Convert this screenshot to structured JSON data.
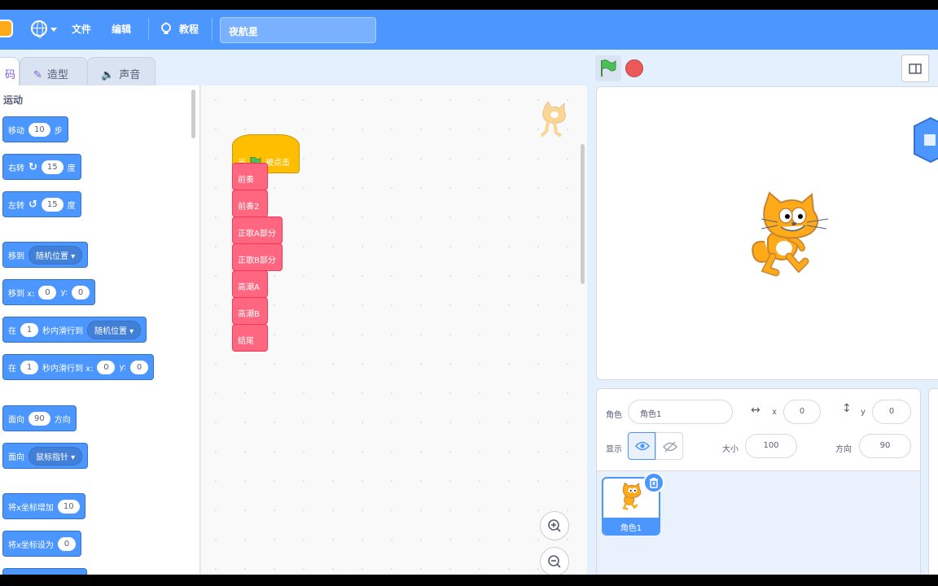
{
  "menubar": {
    "file": "文件",
    "edit": "编辑",
    "tutorials": "教程",
    "project_title": "夜航星"
  },
  "tabs": {
    "code": "码",
    "costumes": "造型",
    "sounds": "声音"
  },
  "palette": {
    "category": "运动",
    "blocks": {
      "move": {
        "a": "移动",
        "v": "10",
        "b": "步"
      },
      "turn_right": {
        "a": "右转",
        "v": "15",
        "b": "度"
      },
      "turn_left": {
        "a": "左转",
        "v": "15",
        "b": "度"
      },
      "goto": {
        "a": "移到",
        "d": "随机位置"
      },
      "goto_xy": {
        "a": "移到 x:",
        "x": "0",
        "ylabel": "y:",
        "y": "0"
      },
      "glide": {
        "a": "在",
        "v": "1",
        "b": "秒内滑行到",
        "d": "随机位置"
      },
      "glide_xy": {
        "a": "在",
        "v": "1",
        "b": "秒内滑行到 x:",
        "x": "0",
        "ylabel": "y:",
        "y": "0"
      },
      "point_dir": {
        "a": "面向",
        "v": "90",
        "b": "方向"
      },
      "point_towards": {
        "a": "面向",
        "d": "鼠标指针"
      },
      "change_x": {
        "a": "将x坐标增加",
        "v": "10"
      },
      "set_x": {
        "a": "将x坐标设为",
        "v": "0"
      }
    }
  },
  "script": {
    "hat": {
      "a": "当",
      "b": "被点击"
    },
    "blocks": [
      "前奏",
      "前奏2",
      "正歌A部分",
      "正歌B部分",
      "高潮A",
      "高潮B",
      "结尾"
    ]
  },
  "sprite_info": {
    "sprite_label": "角色",
    "sprite_name": "角色1",
    "x_label": "x",
    "x": "0",
    "y_label": "y",
    "y": "0",
    "show_label": "显示",
    "size_label": "大小",
    "size": "100",
    "direction_label": "方向",
    "direction": "90"
  },
  "sprite_list": [
    {
      "name": "角色1"
    }
  ],
  "colors": {
    "accent": "#4c97ff",
    "motion": "#4c97ff",
    "events": "#ffbf00",
    "my_blocks": "#ff6680",
    "stop": "#ec5959",
    "green_flag": "#4cbf56"
  }
}
